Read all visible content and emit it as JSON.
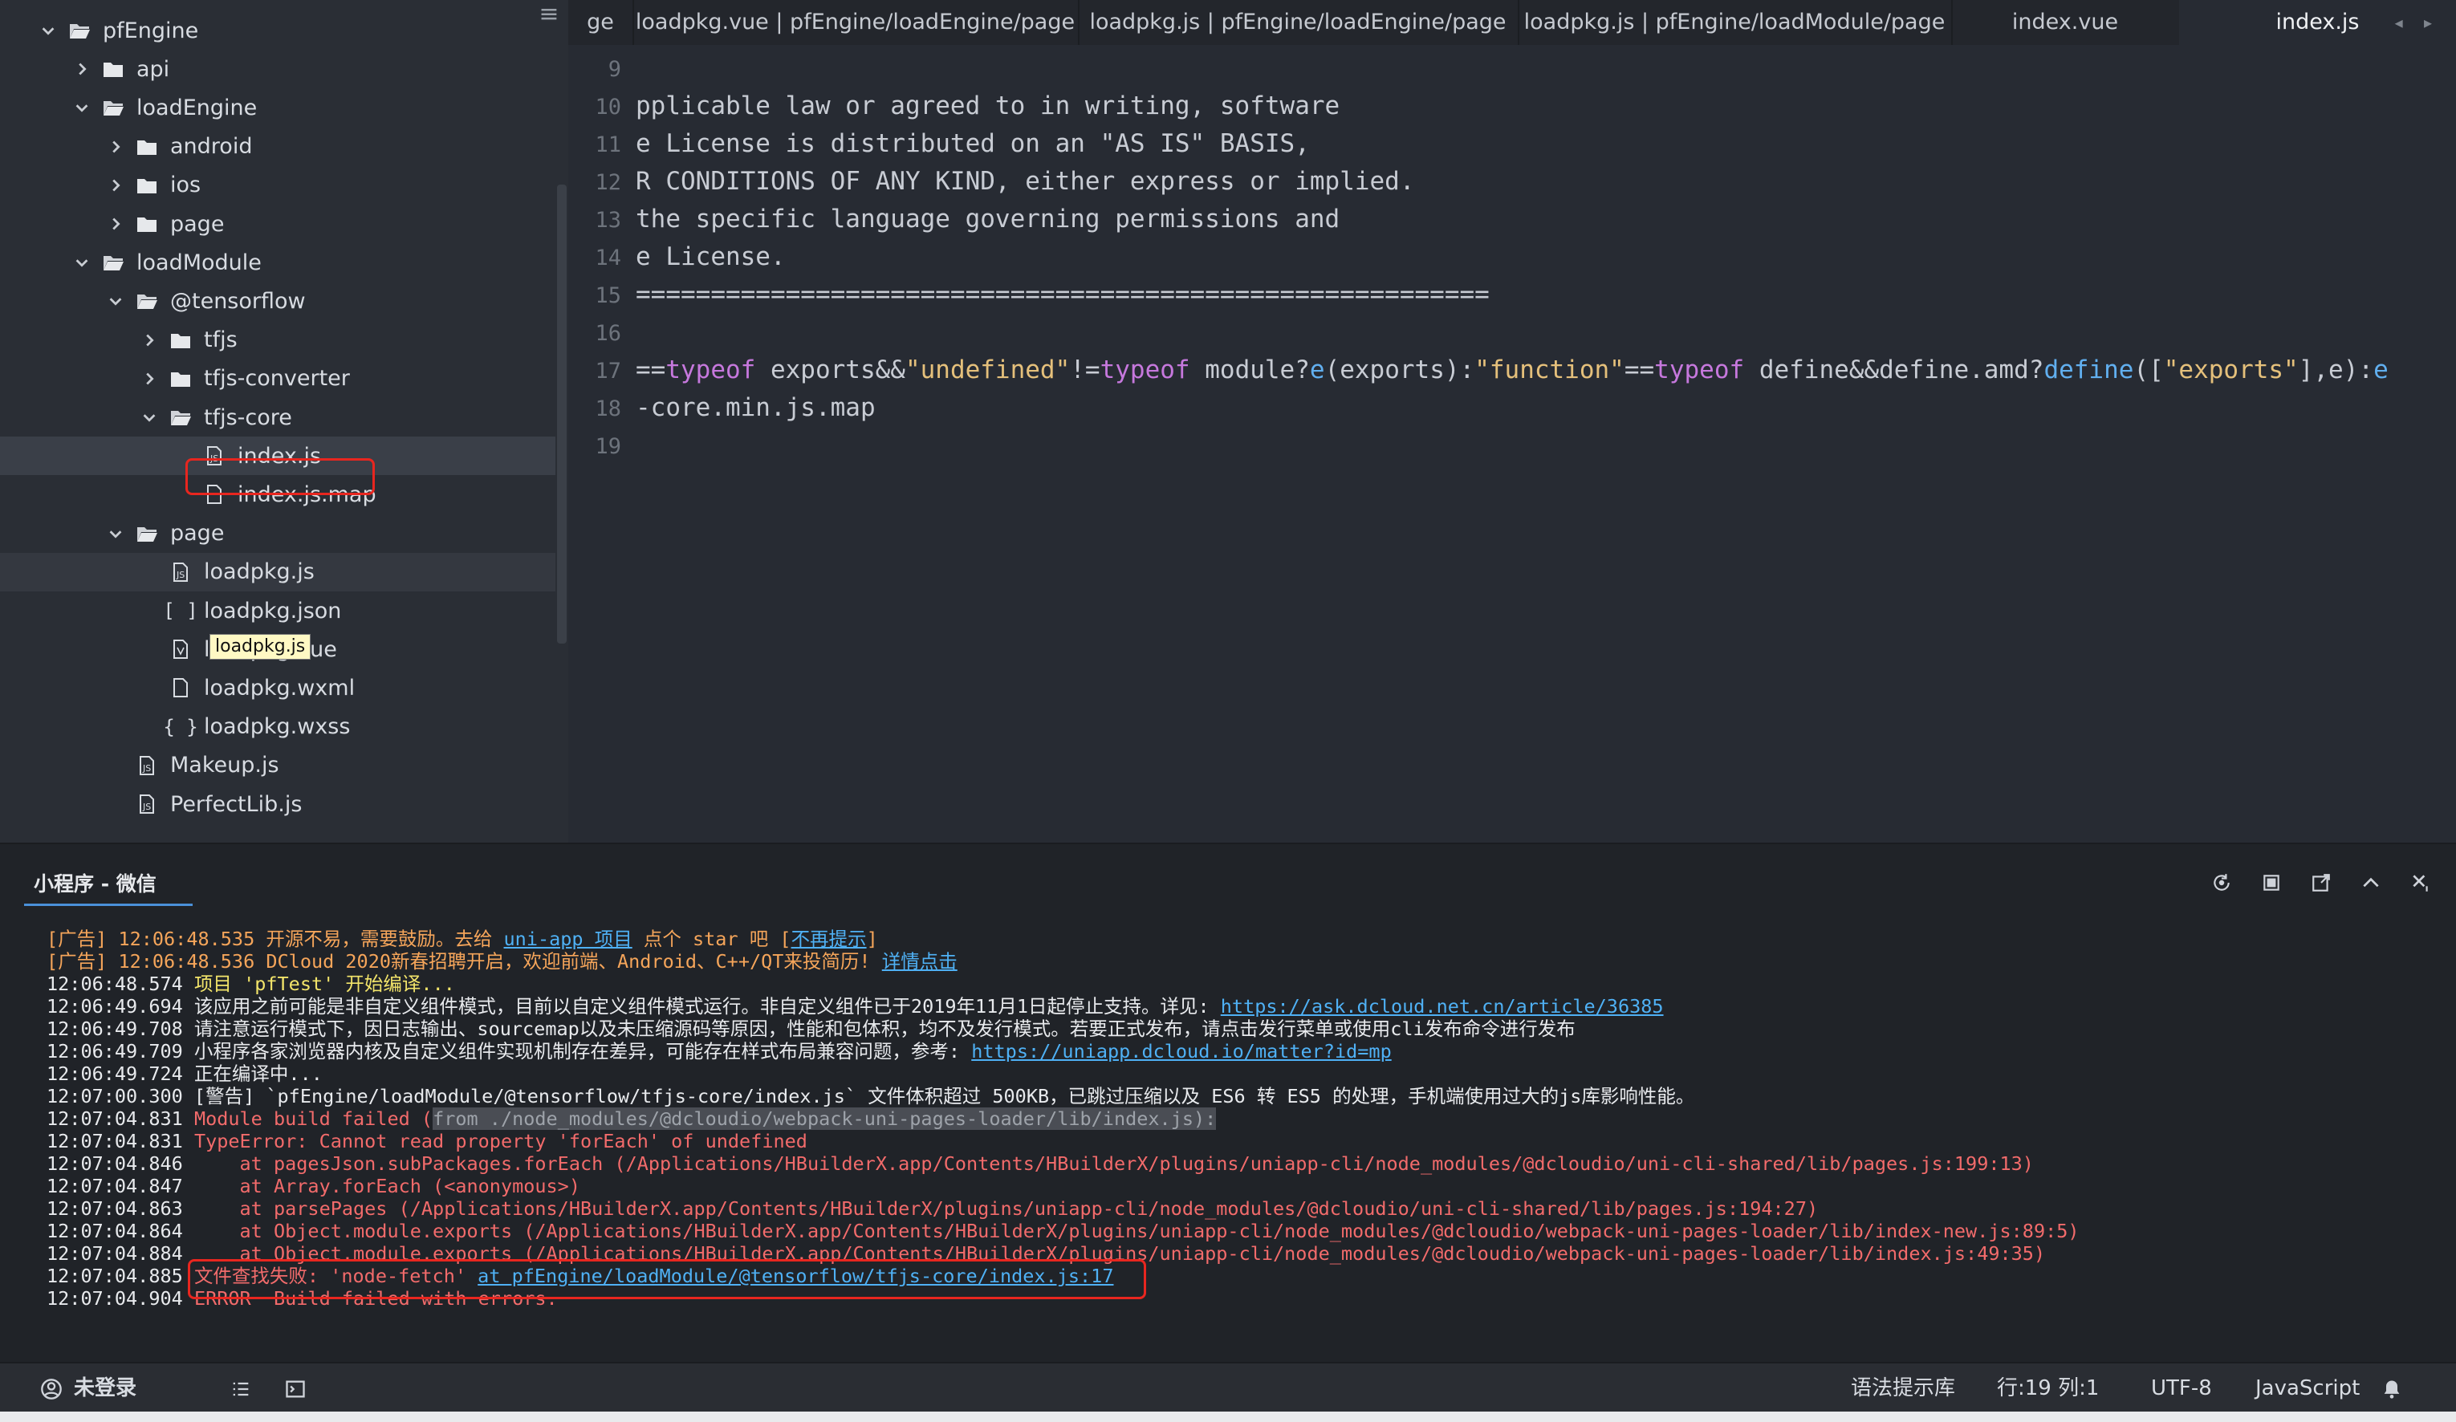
{
  "sidebar": {
    "tooltip": "loadpkg.js",
    "tree": [
      {
        "label": "pfEngine",
        "type": "folder",
        "expanded": true,
        "level": 0
      },
      {
        "label": "api",
        "type": "folder",
        "expanded": false,
        "level": 1
      },
      {
        "label": "loadEngine",
        "type": "folder",
        "expanded": true,
        "level": 1
      },
      {
        "label": "android",
        "type": "folder",
        "expanded": false,
        "level": 2
      },
      {
        "label": "ios",
        "type": "folder",
        "expanded": false,
        "level": 2
      },
      {
        "label": "page",
        "type": "folder",
        "expanded": false,
        "level": 2
      },
      {
        "label": "loadModule",
        "type": "folder",
        "expanded": true,
        "level": 1
      },
      {
        "label": "@tensorflow",
        "type": "folder",
        "expanded": true,
        "level": 2
      },
      {
        "label": "tfjs",
        "type": "folder",
        "expanded": false,
        "level": 3
      },
      {
        "label": "tfjs-converter",
        "type": "folder",
        "expanded": false,
        "level": 3
      },
      {
        "label": "tfjs-core",
        "type": "folder",
        "expanded": true,
        "level": 3
      },
      {
        "label": "index.js",
        "type": "js",
        "level": 4,
        "selected": true
      },
      {
        "label": "index.js.map",
        "type": "file",
        "level": 4
      },
      {
        "label": "page",
        "type": "folder",
        "expanded": true,
        "level": 2
      },
      {
        "label": "loadpkg.js",
        "type": "js",
        "level": 3,
        "hover": true
      },
      {
        "label": "loadpkg.json",
        "type": "json",
        "level": 3
      },
      {
        "label": "loadpkg.vue",
        "type": "vue",
        "level": 3
      },
      {
        "label": "loadpkg.wxml",
        "type": "file",
        "level": 3
      },
      {
        "label": "loadpkg.wxss",
        "type": "wxss",
        "level": 3
      },
      {
        "label": "Makeup.js",
        "type": "js",
        "level": 2
      },
      {
        "label": "PerfectLib.js",
        "type": "js",
        "level": 2
      }
    ]
  },
  "tabs": [
    {
      "label": "ge",
      "active": false
    },
    {
      "label": "loadpkg.vue | pfEngine/loadEngine/page",
      "active": false
    },
    {
      "label": "loadpkg.js | pfEngine/loadEngine/page",
      "active": false
    },
    {
      "label": "loadpkg.js | pfEngine/loadModule/page",
      "active": false
    },
    {
      "label": "index.vue",
      "active": false
    },
    {
      "label": "index.js",
      "active": true
    }
  ],
  "tab_arrows": "◂ ▸",
  "editor": {
    "lines": [
      {
        "n": "9",
        "segs": []
      },
      {
        "n": "10",
        "segs": [
          {
            "t": "pplicable law or agreed to in writing, software",
            "c": ""
          }
        ]
      },
      {
        "n": "11",
        "segs": [
          {
            "t": "e License is distributed on an \"AS IS\" BASIS,",
            "c": ""
          }
        ]
      },
      {
        "n": "12",
        "segs": [
          {
            "t": "R CONDITIONS OF ANY KIND, either express or implied.",
            "c": ""
          }
        ]
      },
      {
        "n": "13",
        "segs": [
          {
            "t": "the specific language governing permissions and",
            "c": ""
          }
        ]
      },
      {
        "n": "14",
        "segs": [
          {
            "t": "e License.",
            "c": ""
          }
        ]
      },
      {
        "n": "15",
        "segs": [
          {
            "t": "=========================================================",
            "c": ""
          }
        ]
      },
      {
        "n": "16",
        "segs": []
      },
      {
        "n": "17",
        "segs": [
          {
            "t": "==",
            "c": ""
          },
          {
            "t": "typeof",
            "c": "kw"
          },
          {
            "t": " exports&&",
            "c": ""
          },
          {
            "t": "\"undefined\"",
            "c": "str"
          },
          {
            "t": "!=",
            "c": ""
          },
          {
            "t": "typeof",
            "c": "kw"
          },
          {
            "t": " module?",
            "c": ""
          },
          {
            "t": "e",
            "c": "fn"
          },
          {
            "t": "(exports):",
            "c": ""
          },
          {
            "t": "\"function\"",
            "c": "str"
          },
          {
            "t": "==",
            "c": ""
          },
          {
            "t": "typeof",
            "c": "kw"
          },
          {
            "t": " define&&define.amd?",
            "c": ""
          },
          {
            "t": "define",
            "c": "fn"
          },
          {
            "t": "([",
            "c": ""
          },
          {
            "t": "\"exports\"",
            "c": "str"
          },
          {
            "t": "],e):",
            "c": ""
          },
          {
            "t": "e",
            "c": "fn"
          }
        ]
      },
      {
        "n": "18",
        "segs": [
          {
            "t": "-core.min.js.map",
            "c": ""
          }
        ]
      },
      {
        "n": "19",
        "segs": []
      }
    ]
  },
  "console": {
    "title": "小程序 - 微信",
    "lines": [
      [
        {
          "t": "[广告] 12:06:48.535 开源不易，需要鼓励。去给 ",
          "c": "c-ad"
        },
        {
          "t": "uni-app 项目",
          "c": "c-link"
        },
        {
          "t": " 点个 star 吧 [",
          "c": "c-ad"
        },
        {
          "t": "不再提示",
          "c": "c-link"
        },
        {
          "t": "]",
          "c": "c-ad"
        }
      ],
      [
        {
          "t": "[广告] 12:06:48.536 DCloud 2020新春招聘开启，欢迎前端、Android、C++/QT来投简历! ",
          "c": "c-ad"
        },
        {
          "t": "详情点击",
          "c": "c-link"
        }
      ],
      [
        {
          "t": "12:06:48.574 ",
          "c": "c-white"
        },
        {
          "t": "项目 'pfTest' 开始编译...",
          "c": "c-yellow"
        }
      ],
      [
        {
          "t": "12:06:49.694 该应用之前可能是非自定义组件模式，目前以自定义组件模式运行。非自定义组件已于2019年11月1日起停止支持。详见: ",
          "c": "c-white"
        },
        {
          "t": "https://ask.dcloud.net.cn/article/36385",
          "c": "c-link"
        }
      ],
      [
        {
          "t": "12:06:49.708 请注意运行模式下，因日志输出、sourcemap以及未压缩源码等原因，性能和包体积，均不及发行模式。若要正式发布，请点击发行菜单或使用cli发布命令进行发布",
          "c": "c-white"
        }
      ],
      [
        {
          "t": "12:06:49.709 小程序各家浏览器内核及自定义组件实现机制存在差异，可能存在样式布局兼容问题，参考: ",
          "c": "c-white"
        },
        {
          "t": "https://uniapp.dcloud.io/matter?id=mp",
          "c": "c-link"
        }
      ],
      [
        {
          "t": "12:06:49.724 正在编译中...",
          "c": "c-white"
        }
      ],
      [
        {
          "t": "12:07:00.300 [警告] `pfEngine/loadModule/@tensorflow/tfjs-core/index.js` 文件体积超过 500KB，已跳过压缩以及 ES6 转 ES5 的处理，手机端使用过大的js库影响性能。",
          "c": "c-white"
        }
      ],
      [
        {
          "t": "12:07:04.831 ",
          "c": "c-white"
        },
        {
          "t": "Module build failed (",
          "c": "c-red"
        },
        {
          "t": "from ./node_modules/@dcloudio/webpack-uni-pages-loader/lib/index.js):",
          "c": "c-dim"
        }
      ],
      [
        {
          "t": "12:07:04.831 ",
          "c": "c-white"
        },
        {
          "t": "TypeError: Cannot read property 'forEach' of undefined",
          "c": "c-red"
        }
      ],
      [
        {
          "t": "12:07:04.846 ",
          "c": "c-white"
        },
        {
          "t": "    at pagesJson.subPackages.forEach (/Applications/HBuilderX.app/Contents/HBuilderX/plugins/uniapp-cli/node_modules/@dcloudio/uni-cli-shared/lib/pages.js:199:13)",
          "c": "c-red"
        }
      ],
      [
        {
          "t": "12:07:04.847 ",
          "c": "c-white"
        },
        {
          "t": "    at Array.forEach (<anonymous>)",
          "c": "c-red"
        }
      ],
      [
        {
          "t": "12:07:04.863 ",
          "c": "c-white"
        },
        {
          "t": "    at parsePages (/Applications/HBuilderX.app/Contents/HBuilderX/plugins/uniapp-cli/node_modules/@dcloudio/uni-cli-shared/lib/pages.js:194:27)",
          "c": "c-red"
        }
      ],
      [
        {
          "t": "12:07:04.864 ",
          "c": "c-white"
        },
        {
          "t": "    at Object.module.exports (/Applications/HBuilderX.app/Contents/HBuilderX/plugins/uniapp-cli/node_modules/@dcloudio/webpack-uni-pages-loader/lib/index-new.js:89:5)",
          "c": "c-red"
        }
      ],
      [
        {
          "t": "12:07:04.884 ",
          "c": "c-white"
        },
        {
          "t": "    at Object.module.exports (/Applications/HBuilderX.app/Contents/HBuilderX/plugins/uniapp-cli/node_modules/@dcloudio/webpack-uni-pages-loader/lib/index.js:49:35)",
          "c": "c-red"
        }
      ],
      [
        {
          "t": "12:07:04.885 ",
          "c": "c-white"
        },
        {
          "t": "文件查找失败: 'node-fetch' ",
          "c": "c-red"
        },
        {
          "t": "at pfEngine/loadModule/@tensorflow/tfjs-core/index.js:17",
          "c": "c-link"
        }
      ],
      [
        {
          "t": "12:07:04.904 ",
          "c": "c-white"
        },
        {
          "t": "ERROR  Build failed with errors.",
          "c": "c-red"
        }
      ]
    ]
  },
  "statusbar": {
    "login": "未登录",
    "syntax_lib": "语法提示库",
    "position": "行:19  列:1",
    "encoding": "UTF-8",
    "language": "JavaScript"
  },
  "colors": {
    "accent": "#4a90d9",
    "highlight_box": "#e8261f"
  }
}
